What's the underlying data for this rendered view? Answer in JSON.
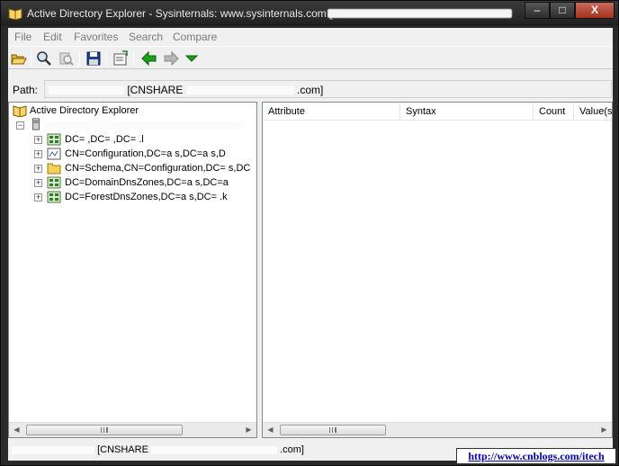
{
  "window": {
    "title": "Active Directory Explorer - Sysinternals: www.sysinternals.com [",
    "min_label": "‒",
    "max_label": "□",
    "close_label": "X"
  },
  "menu": {
    "items": [
      {
        "label": "File"
      },
      {
        "label": "Edit"
      },
      {
        "label": "Favorites"
      },
      {
        "label": "Search"
      },
      {
        "label": "Compare"
      }
    ]
  },
  "toolbar": {
    "icons": [
      "open-folder-icon",
      "search-icon",
      "search-disabled-icon",
      "save-icon",
      "properties-icon",
      "back-arrow-icon",
      "forward-arrow-icon",
      "dropdown-arrow-icon"
    ]
  },
  "path": {
    "label": "Path:",
    "value_prefix": "",
    "value_visible": "[CNSHARE",
    "value_tail": ".com]"
  },
  "tree": {
    "root_label": "Active Directory Explorer",
    "server_tail": "",
    "nodes": [
      {
        "label": "DC=   ,DC=      ,DC=   .l"
      },
      {
        "label": "CN=Configuration,DC=a  s,DC=a      s,D"
      },
      {
        "label": "CN=Schema,CN=Configuration,DC=    s,DC"
      },
      {
        "label": "DC=DomainDnsZones,DC=a  s,DC=a"
      },
      {
        "label": "DC=ForestDnsZones,DC=a  s,DC=       .k"
      }
    ]
  },
  "list": {
    "columns": [
      "Attribute",
      "Syntax",
      "Count",
      "Value(s"
    ]
  },
  "status": {
    "text_visible": "[CNSHARE",
    "text_tail": ".com]"
  },
  "watermark": {
    "text": "http://www.cnblogs.com/itech"
  },
  "colors": {
    "titlebar": "#2a2a2a",
    "close_button": "#c0402c",
    "back_arrow": "#1aa31a",
    "watermark_text": "#0000aa"
  }
}
